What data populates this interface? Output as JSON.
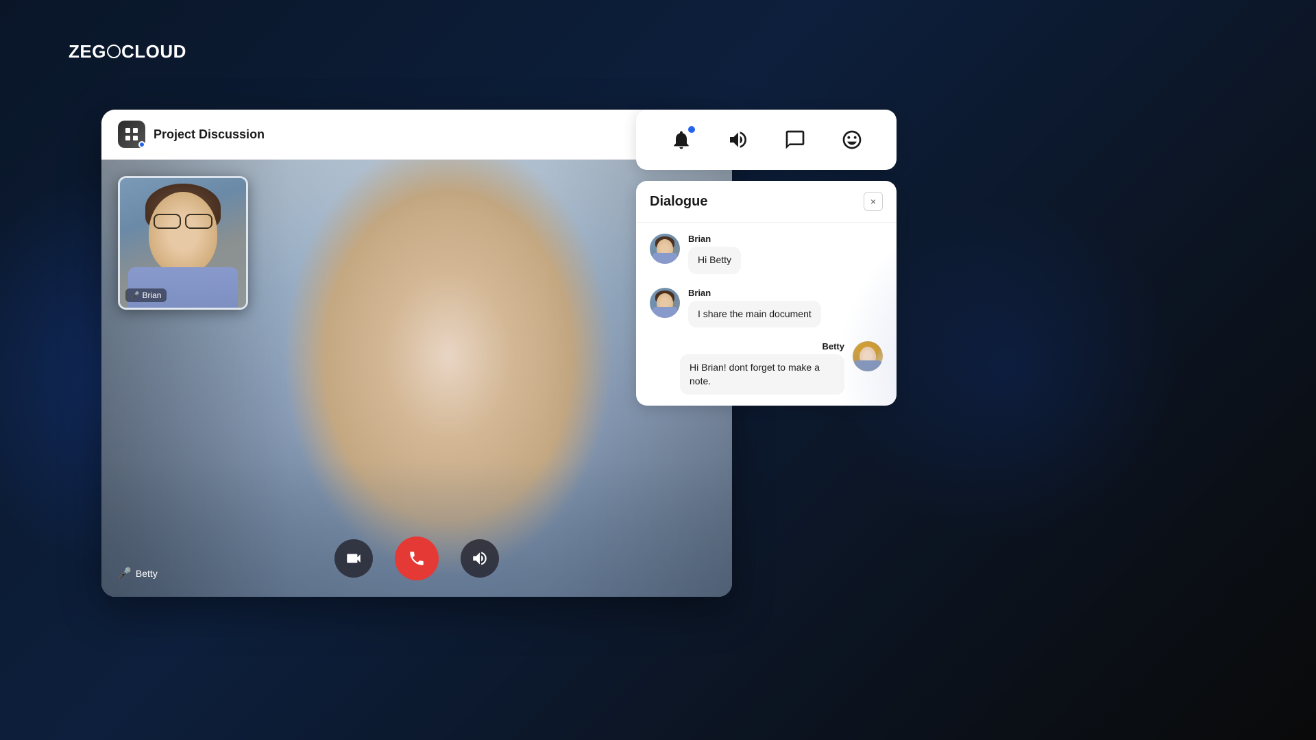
{
  "brand": {
    "logo_text_1": "ZEG",
    "logo_text_2": "CLOUD",
    "logo_o": "O"
  },
  "app": {
    "window_title": "Project Discussion",
    "header_icon_alt": "grid-pattern"
  },
  "video": {
    "main_participant": "Betty",
    "pip_participant": "Brian"
  },
  "controls": {
    "camera_label": "Camera",
    "end_call_label": "End Call",
    "volume_label": "Volume"
  },
  "toolbar": {
    "notification_label": "Notifications",
    "sound_label": "Sound",
    "chat_label": "Chat",
    "emoji_label": "Emoji"
  },
  "dialogue": {
    "title": "Dialogue",
    "close_label": "×",
    "messages": [
      {
        "sender": "Brian",
        "text": "Hi Betty",
        "align": "left"
      },
      {
        "sender": "Brian",
        "text": "I share the main document",
        "align": "left"
      },
      {
        "sender": "Betty",
        "text": "Hi Brian! dont forget to make a note.",
        "align": "right"
      }
    ]
  }
}
